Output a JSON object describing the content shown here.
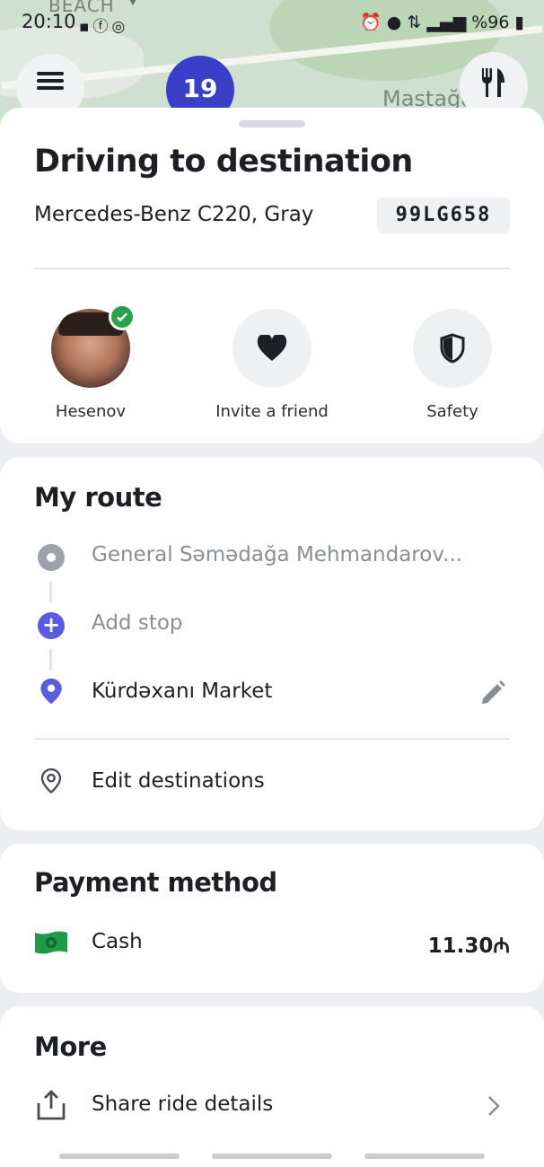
{
  "status_bar": {
    "time": "20:10",
    "left_icons": [
      "dropbox-icon",
      "facebook-icon",
      "instagram-icon"
    ],
    "right_icons": [
      "alarm-icon",
      "location-icon",
      "data-icon",
      "signal-icon"
    ],
    "battery": "%96"
  },
  "map": {
    "labels": [
      "BEACH",
      "Mastağa"
    ],
    "eta_badge": "19"
  },
  "trip": {
    "title": "Driving to destination",
    "car": "Mercedes-Benz C220, Gray",
    "plate": "99LG658",
    "actions": [
      {
        "label": "Hesenov",
        "icon": "avatar"
      },
      {
        "label": "Invite a friend",
        "icon": "heart-icon"
      },
      {
        "label": "Safety",
        "icon": "shield-icon"
      }
    ]
  },
  "route": {
    "title": "My route",
    "pickup": "General Səmədağa Mehmandarov...",
    "add_stop": "Add stop",
    "destination": "Kürdəxanı Market",
    "edit_destinations": "Edit destinations"
  },
  "payment": {
    "title": "Payment method",
    "method": "Cash",
    "amount": "11.30₼"
  },
  "more": {
    "title": "More",
    "share": "Share ride details"
  },
  "colors": {
    "accent": "#5b5bdf",
    "verified": "#2ba24a",
    "cash": "#1f9a4a"
  }
}
